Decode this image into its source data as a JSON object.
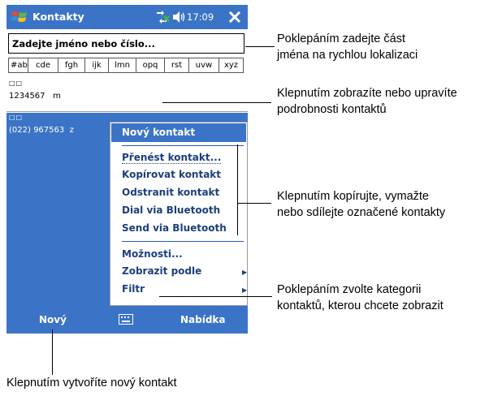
{
  "titlebar": {
    "title": "Kontakty",
    "time": "17:09"
  },
  "search": {
    "placeholder": "Zadejte jméno nebo číslo..."
  },
  "index_tabs": [
    "#ab",
    "cde",
    "fgh",
    "ijk",
    "lmn",
    "opq",
    "rst",
    "uvw",
    "xyz"
  ],
  "contacts": [
    {
      "name_glyph": "□□",
      "phone": "1234567",
      "tag": "m"
    },
    {
      "name_glyph": "□□",
      "phone": "(022) 967563",
      "tag": "z"
    }
  ],
  "menu": {
    "header": "Nový kontakt",
    "items": [
      "Přenést kontakt...",
      "Kopírovat kontakt",
      "Odstranit kontakt",
      "Dial via Bluetooth",
      "Send via Bluetooth"
    ],
    "items2": [
      "Možnosti...",
      "Zobrazit podle",
      "Filtr"
    ]
  },
  "cmdbar": {
    "left": "Nový",
    "right": "Nabídka"
  },
  "callouts": {
    "search_line1": "Poklepáním zadejte část",
    "search_line2": "jména na rychlou lokalizaci",
    "details_line1": "Klepnutím zobrazíte nebo upravíte",
    "details_line2": "podrobnosti kontaktů",
    "menu_line1": "Klepnutím kopírujte, vymažte",
    "menu_line2": "nebo sdílejte označené kontakty",
    "filter_line1": "Poklepáním zvolte kategorii",
    "filter_line2": "kontaktů, kterou chcete zobrazit",
    "new_line": "Klepnutím vytvoříte nový kontakt"
  },
  "colors": {
    "accent": "#3b74c6",
    "menu_text": "#1c3f7c"
  },
  "icons": [
    "windows-flag-icon",
    "connectivity-icon",
    "speaker-icon",
    "close-icon",
    "keyboard-icon",
    "submenu-arrow-icon"
  ]
}
